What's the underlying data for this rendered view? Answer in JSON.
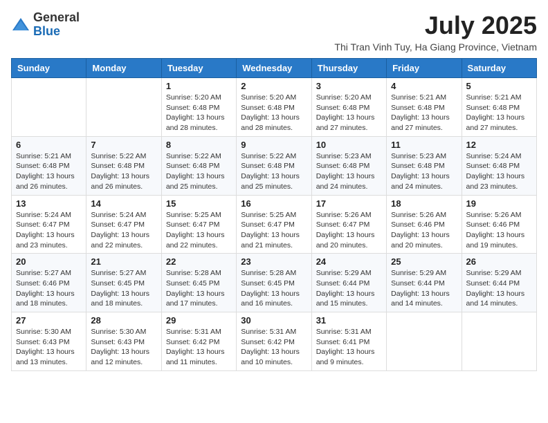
{
  "logo": {
    "general": "General",
    "blue": "Blue"
  },
  "header": {
    "month": "July 2025",
    "location": "Thi Tran Vinh Tuy, Ha Giang Province, Vietnam"
  },
  "days_of_week": [
    "Sunday",
    "Monday",
    "Tuesday",
    "Wednesday",
    "Thursday",
    "Friday",
    "Saturday"
  ],
  "weeks": [
    [
      {
        "day": "",
        "info": ""
      },
      {
        "day": "",
        "info": ""
      },
      {
        "day": "1",
        "info": "Sunrise: 5:20 AM\nSunset: 6:48 PM\nDaylight: 13 hours and 28 minutes."
      },
      {
        "day": "2",
        "info": "Sunrise: 5:20 AM\nSunset: 6:48 PM\nDaylight: 13 hours and 28 minutes."
      },
      {
        "day": "3",
        "info": "Sunrise: 5:20 AM\nSunset: 6:48 PM\nDaylight: 13 hours and 27 minutes."
      },
      {
        "day": "4",
        "info": "Sunrise: 5:21 AM\nSunset: 6:48 PM\nDaylight: 13 hours and 27 minutes."
      },
      {
        "day": "5",
        "info": "Sunrise: 5:21 AM\nSunset: 6:48 PM\nDaylight: 13 hours and 27 minutes."
      }
    ],
    [
      {
        "day": "6",
        "info": "Sunrise: 5:21 AM\nSunset: 6:48 PM\nDaylight: 13 hours and 26 minutes."
      },
      {
        "day": "7",
        "info": "Sunrise: 5:22 AM\nSunset: 6:48 PM\nDaylight: 13 hours and 26 minutes."
      },
      {
        "day": "8",
        "info": "Sunrise: 5:22 AM\nSunset: 6:48 PM\nDaylight: 13 hours and 25 minutes."
      },
      {
        "day": "9",
        "info": "Sunrise: 5:22 AM\nSunset: 6:48 PM\nDaylight: 13 hours and 25 minutes."
      },
      {
        "day": "10",
        "info": "Sunrise: 5:23 AM\nSunset: 6:48 PM\nDaylight: 13 hours and 24 minutes."
      },
      {
        "day": "11",
        "info": "Sunrise: 5:23 AM\nSunset: 6:48 PM\nDaylight: 13 hours and 24 minutes."
      },
      {
        "day": "12",
        "info": "Sunrise: 5:24 AM\nSunset: 6:48 PM\nDaylight: 13 hours and 23 minutes."
      }
    ],
    [
      {
        "day": "13",
        "info": "Sunrise: 5:24 AM\nSunset: 6:47 PM\nDaylight: 13 hours and 23 minutes."
      },
      {
        "day": "14",
        "info": "Sunrise: 5:24 AM\nSunset: 6:47 PM\nDaylight: 13 hours and 22 minutes."
      },
      {
        "day": "15",
        "info": "Sunrise: 5:25 AM\nSunset: 6:47 PM\nDaylight: 13 hours and 22 minutes."
      },
      {
        "day": "16",
        "info": "Sunrise: 5:25 AM\nSunset: 6:47 PM\nDaylight: 13 hours and 21 minutes."
      },
      {
        "day": "17",
        "info": "Sunrise: 5:26 AM\nSunset: 6:47 PM\nDaylight: 13 hours and 20 minutes."
      },
      {
        "day": "18",
        "info": "Sunrise: 5:26 AM\nSunset: 6:46 PM\nDaylight: 13 hours and 20 minutes."
      },
      {
        "day": "19",
        "info": "Sunrise: 5:26 AM\nSunset: 6:46 PM\nDaylight: 13 hours and 19 minutes."
      }
    ],
    [
      {
        "day": "20",
        "info": "Sunrise: 5:27 AM\nSunset: 6:46 PM\nDaylight: 13 hours and 18 minutes."
      },
      {
        "day": "21",
        "info": "Sunrise: 5:27 AM\nSunset: 6:45 PM\nDaylight: 13 hours and 18 minutes."
      },
      {
        "day": "22",
        "info": "Sunrise: 5:28 AM\nSunset: 6:45 PM\nDaylight: 13 hours and 17 minutes."
      },
      {
        "day": "23",
        "info": "Sunrise: 5:28 AM\nSunset: 6:45 PM\nDaylight: 13 hours and 16 minutes."
      },
      {
        "day": "24",
        "info": "Sunrise: 5:29 AM\nSunset: 6:44 PM\nDaylight: 13 hours and 15 minutes."
      },
      {
        "day": "25",
        "info": "Sunrise: 5:29 AM\nSunset: 6:44 PM\nDaylight: 13 hours and 14 minutes."
      },
      {
        "day": "26",
        "info": "Sunrise: 5:29 AM\nSunset: 6:44 PM\nDaylight: 13 hours and 14 minutes."
      }
    ],
    [
      {
        "day": "27",
        "info": "Sunrise: 5:30 AM\nSunset: 6:43 PM\nDaylight: 13 hours and 13 minutes."
      },
      {
        "day": "28",
        "info": "Sunrise: 5:30 AM\nSunset: 6:43 PM\nDaylight: 13 hours and 12 minutes."
      },
      {
        "day": "29",
        "info": "Sunrise: 5:31 AM\nSunset: 6:42 PM\nDaylight: 13 hours and 11 minutes."
      },
      {
        "day": "30",
        "info": "Sunrise: 5:31 AM\nSunset: 6:42 PM\nDaylight: 13 hours and 10 minutes."
      },
      {
        "day": "31",
        "info": "Sunrise: 5:31 AM\nSunset: 6:41 PM\nDaylight: 13 hours and 9 minutes."
      },
      {
        "day": "",
        "info": ""
      },
      {
        "day": "",
        "info": ""
      }
    ]
  ]
}
